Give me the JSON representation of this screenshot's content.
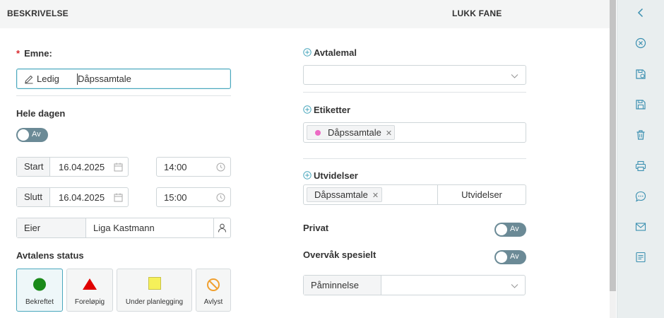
{
  "header": {
    "tab_label": "BESKRIVELSE",
    "close_tab_label": "LUKK FANE"
  },
  "subject": {
    "label": "Emne",
    "required_marker": "*",
    "colon": ":",
    "value_before_caret": "Ledig",
    "value_after_caret": "Dåpssamtale"
  },
  "all_day": {
    "label": "Hele dagen",
    "toggle_text": "Av"
  },
  "start": {
    "label": "Start",
    "date": "16.04.2025",
    "time": "14:00"
  },
  "end": {
    "label": "Slutt",
    "date": "16.04.2025",
    "time": "15:00"
  },
  "owner": {
    "label": "Eier",
    "value": "Liga Kastmann"
  },
  "status": {
    "label": "Avtalens status",
    "options": [
      {
        "label": "Bekreftet",
        "shape": "circle",
        "color": "#1a8a1a",
        "selected": true
      },
      {
        "label": "Foreløpig",
        "shape": "triangle",
        "color": "#e00000",
        "selected": false
      },
      {
        "label": "Under planlegging",
        "shape": "square",
        "color": "#f5f05a",
        "selected": false
      },
      {
        "label": "Avlyst",
        "shape": "cancel",
        "color": "#f0a030",
        "selected": false
      }
    ]
  },
  "template": {
    "label": "Avtalemal",
    "value": ""
  },
  "labels": {
    "label": "Etiketter",
    "tags": [
      {
        "text": "Dåpssamtale",
        "dot_color": "#ec6bc4"
      }
    ]
  },
  "extensions": {
    "label": "Utvidelser",
    "tags": [
      {
        "text": "Dåpssamtale"
      }
    ],
    "button_label": "Utvidelser"
  },
  "private": {
    "label": "Privat",
    "toggle_text": "Av"
  },
  "monitor": {
    "label": "Overvåk spesielt",
    "toggle_text": "Av"
  },
  "reminder": {
    "label": "Påminnelse",
    "value": ""
  },
  "colors": {
    "accent": "#4aa7bd",
    "toggle_off": "#6b8a96"
  },
  "sidebar_icons": [
    "chevron-left-icon",
    "close-circle-icon",
    "save-as-icon",
    "save-icon",
    "trash-icon",
    "print-icon",
    "chat-icon",
    "mail-icon",
    "note-icon"
  ]
}
